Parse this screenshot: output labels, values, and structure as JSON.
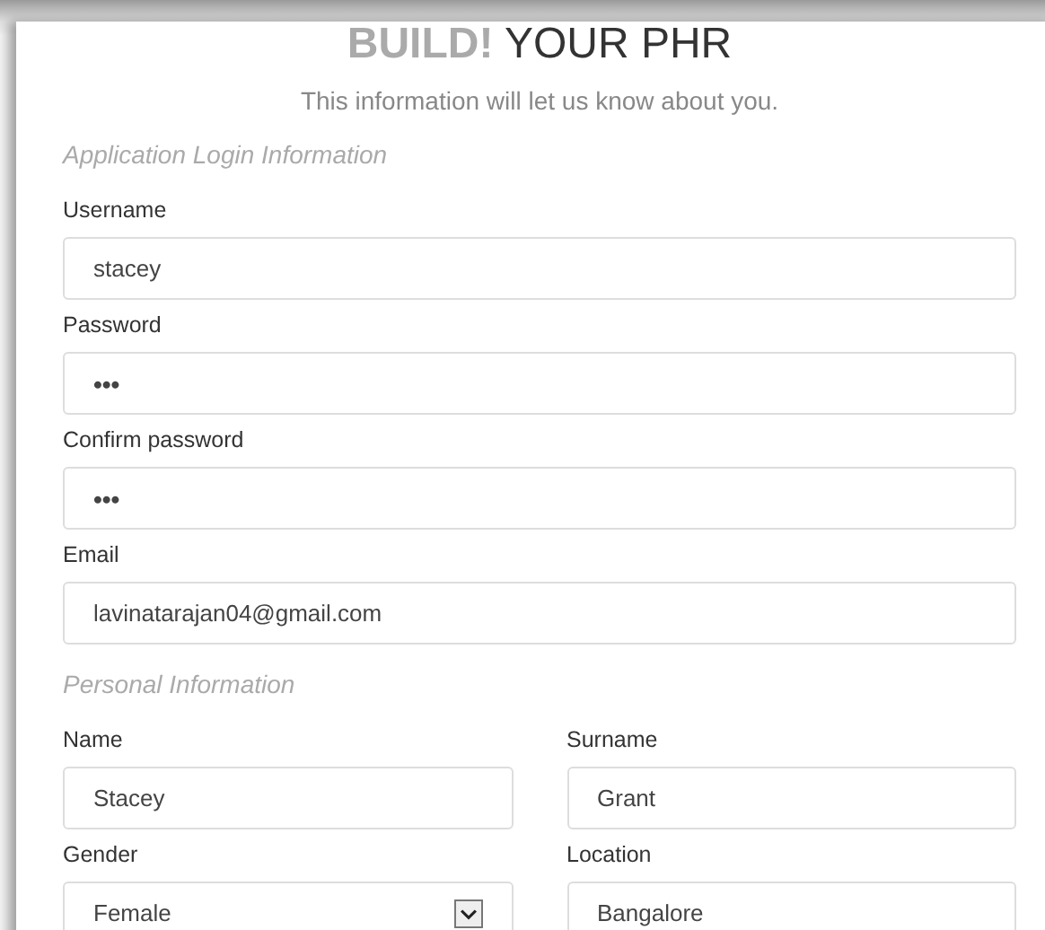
{
  "title": {
    "emphasis": "BUILD!",
    "rest": "YOUR PHR"
  },
  "subtitle": "This information will let us know about you.",
  "sections": [
    {
      "heading": "Application Login Information",
      "rows": [
        [
          {
            "label": "Username",
            "value": "stacey",
            "kind": "text"
          }
        ],
        [
          {
            "label": "Password",
            "value": "•••",
            "kind": "password"
          }
        ],
        [
          {
            "label": "Confirm password",
            "value": "•••",
            "kind": "password"
          }
        ],
        [
          {
            "label": "Email",
            "value": "lavinatarajan04@gmail.com",
            "kind": "text"
          }
        ]
      ]
    },
    {
      "heading": "Personal Information",
      "rows": [
        [
          {
            "label": "Name",
            "value": "Stacey",
            "kind": "text"
          },
          {
            "label": "Surname",
            "value": "Grant",
            "kind": "text"
          }
        ],
        [
          {
            "label": "Gender",
            "value": "Female",
            "kind": "select"
          },
          {
            "label": "Location",
            "value": "Bangalore",
            "kind": "text"
          }
        ]
      ]
    }
  ]
}
